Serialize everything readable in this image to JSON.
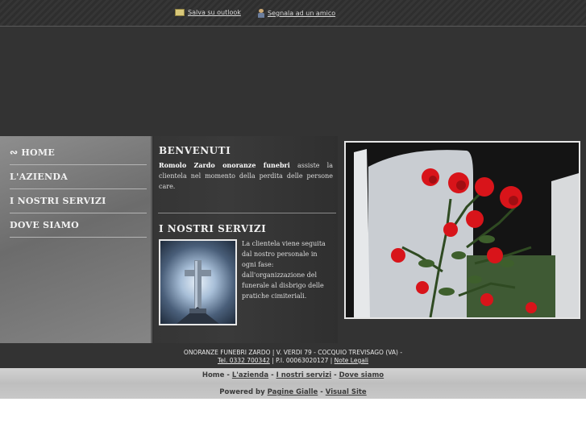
{
  "topbar": {
    "save_outlook": "Salva su outlook",
    "recommend_friend": "Segnala ad un amico"
  },
  "nav": {
    "items": [
      {
        "label": "HOME"
      },
      {
        "label": "L'AZIENDA"
      },
      {
        "label": "I NOSTRI SERVIZI"
      },
      {
        "label": "DOVE SIAMO"
      }
    ]
  },
  "welcome": {
    "title": "BENVENUTI",
    "company_bold": "Romolo Zardo onoranze funebri",
    "text": " assiste la clientela nel momento della perdita delle persone care."
  },
  "services": {
    "title": "I NOSTRI SERVIZI",
    "text": "La clientela viene seguita dal nostro personale in ogni fase: dall'organizzazione del funerale al disbrigo delle pratiche cimiteriali."
  },
  "footer": {
    "address": "ONORANZE FUNEBRI ZARDO | V. VERDI 79 - COCQUIO TREVISAGO (VA) -",
    "phone": "Tel. 0332 700342",
    "vat": " | P.I. 00063020127 | ",
    "legal": "Note Legali"
  },
  "bottom_nav": {
    "home": "Home",
    "azienda": "L'azienda",
    "servizi": "I nostri servizi",
    "dove": "Dove siamo",
    "sep1": " - ",
    "sep2": " - ",
    "sep3": " - "
  },
  "powered": {
    "prefix": "Powered by ",
    "pagine_gialle": "Pagine Gialle",
    "sep": " - ",
    "visual_site": "Visual Site"
  },
  "colors": {
    "background_dark": "#333333",
    "sidebar": "#7a7a7a",
    "footer_light": "#c8c8c8",
    "rose_red": "#d8141a"
  }
}
